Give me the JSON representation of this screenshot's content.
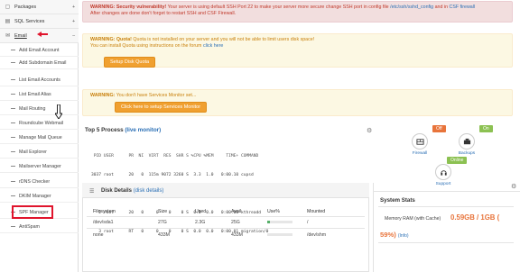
{
  "sidebar": {
    "top_items": [
      {
        "label": "Packages",
        "icon": "box-icon",
        "caret": "+"
      },
      {
        "label": "SQL Services",
        "icon": "database-icon",
        "caret": "+"
      },
      {
        "label": "Email",
        "icon": "email-icon",
        "caret": "–"
      }
    ],
    "email_items": [
      "Add Email Account",
      "Add Subdomain Email",
      "List Email Accounts",
      "List Email Alias",
      "Mail Routing",
      "Roundcube Webmail",
      "Manage Mail Queue",
      "Mail Explorer",
      "Mailserver Manager",
      "rDNS Checker",
      "DKIM Manager",
      "SPF Manager",
      "AntiSpam"
    ]
  },
  "alerts": {
    "security": {
      "strong": "WARNING: Security vulnerability!",
      "text": "Your server is using default SSH Port 22 to make your server more secure change SSH port in config file",
      "link1": "/etc/ssh/sshd_config",
      "mid": "and in",
      "link2": "CSF firewall",
      "line2": "After changes are done don't forget to restart SSH and CSF Firewall."
    },
    "quota": {
      "strong": "WARNING: Quota!",
      "text": "Quota is not installed on your server and you will not be able to limit users disk space!",
      "line2": "You can install Quota using instructions on the forum",
      "link": "click here",
      "button": "Setup Disk Quota"
    },
    "monitor": {
      "strong": "WARNING:",
      "text": "You don't have Services Monitor set...",
      "button": "Click here to setup Services Monitor"
    }
  },
  "top_process": {
    "title": "Top 5 Process",
    "link": "(live monitor)",
    "header": " PID USER      PR  NI  VIRT  RES  SHR S %CPU %MEM     TIME+ COMMAND",
    "rows": [
      "3037 root      20   0  115m 9072 3260 S  3.3  1.0   0:00.10 cupsd",
      "   1 root      20   0 19252 1484 1152 S  0.0  0.2   0:03.75 init",
      "   2 root      20   0     0    0    0 S  0.0  0.0   0:00.00 kthreadd",
      "   3 root      RT   0     0    0    0 S  0.0  0.0   0:00.01 migration/0"
    ]
  },
  "services": {
    "firewall": {
      "label": "Firewall",
      "status": "Off"
    },
    "backups": {
      "label": "Backups",
      "status": "On"
    },
    "support": {
      "label": "Support",
      "status": "Online"
    }
  },
  "disk": {
    "title": "Disk Details",
    "link": "(disk details)",
    "columns": [
      "Filesystem",
      "Size",
      "Used",
      "Avail",
      "Use%",
      "Mounted"
    ],
    "rows": [
      {
        "fs": "/dev/sda1",
        "size": "27G",
        "used": "2.3G",
        "avail": "25G",
        "use_pct": 9,
        "mount": "/"
      },
      {
        "fs": "none",
        "size": "433M",
        "used": "",
        "avail": "433M",
        "use_pct": 0,
        "mount": "/dev/shm"
      }
    ]
  },
  "system_stats": {
    "title": "System Stats",
    "memory_label": "Memory RAM (with Cache)",
    "memory_value": "0.59GB / 1GB (",
    "memory_pct": "59%)",
    "memory_link": "(Info)"
  },
  "colors": {
    "accent_orange": "#f0a030",
    "link_blue": "#2a6fb5",
    "highlight_red": "#e0142c",
    "status_off": "#e8743b",
    "status_on": "#8cc152"
  }
}
